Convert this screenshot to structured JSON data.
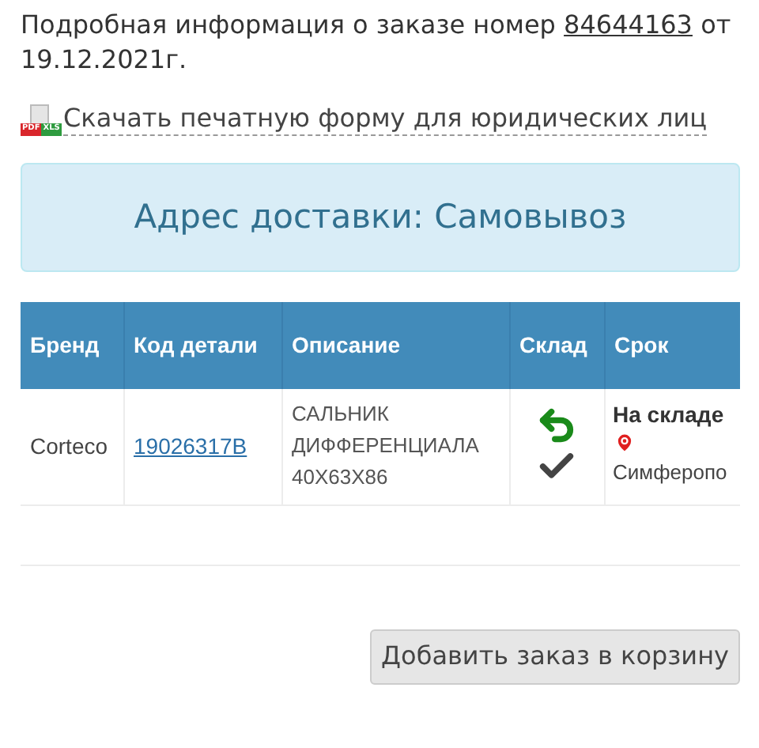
{
  "order_info": {
    "prefix": "Подробная информация о заказе номер",
    "order_number": "84644163",
    "suffix": "от 19.12.2021г."
  },
  "download_link": {
    "label": "Скачать печатную форму для юридических лиц",
    "icon_labels": [
      "PDF",
      "XLS"
    ]
  },
  "delivery": {
    "label": "Адрес доставки:",
    "value": "Самовывоз"
  },
  "table": {
    "columns": [
      "Бренд",
      "Код детали",
      "Описание",
      "Склад",
      "Срок"
    ],
    "rows": [
      {
        "brand": "Corteco",
        "part_code": "19026317B",
        "description": "САЛЬНИК ДИФФЕРЕНЦИАЛА 40X63X86",
        "returnable": true,
        "in_stock": true,
        "term": "На складе",
        "location": "Симферопо"
      }
    ]
  },
  "add_button": {
    "label": "Добавить заказ в корзину"
  }
}
